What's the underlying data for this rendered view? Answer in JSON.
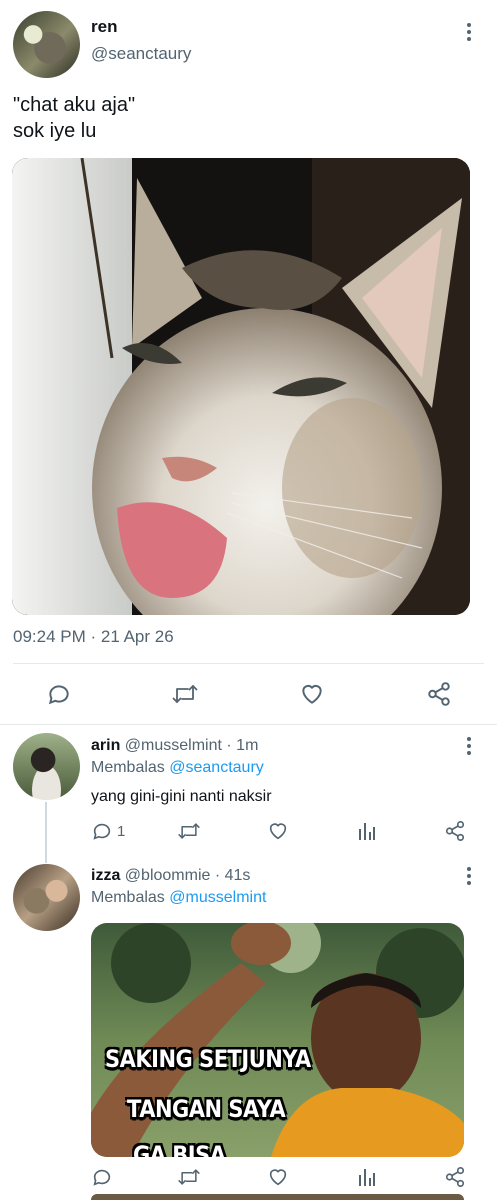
{
  "main_tweet": {
    "name": "ren",
    "handle": "@seanctaury",
    "text": "\"chat aku aja\"\nsok iye lu",
    "timestamp": "09:24 PM · 21 Apr 26",
    "avatar_icon": "profile-photo-avatar"
  },
  "replies": [
    {
      "name": "arin",
      "handle_time": "@musselmint · 1m",
      "replying_prefix": "Membalas",
      "replying_to": "@seanctaury",
      "text": "yang gini-gini nanti naksir",
      "reply_count": "1"
    },
    {
      "name": "izza",
      "handle_time": "@bloommie · 41s",
      "replying_prefix": "Membalas",
      "replying_to": "@musselmint",
      "meme_lines": [
        "SAKING SETJUNYA",
        "TANGAN SAYA",
        "GA BISA"
      ]
    }
  ],
  "icons": {
    "reply": "speech-bubble-icon",
    "retweet": "retweet-icon",
    "like": "heart-icon",
    "share": "share-icon",
    "views": "bar-chart-icon",
    "more": "vertical-dots-icon"
  },
  "colors": {
    "text": "#0f1419",
    "secondary": "#536471",
    "link": "#1d9bf0",
    "divider": "#e6e9eb"
  }
}
